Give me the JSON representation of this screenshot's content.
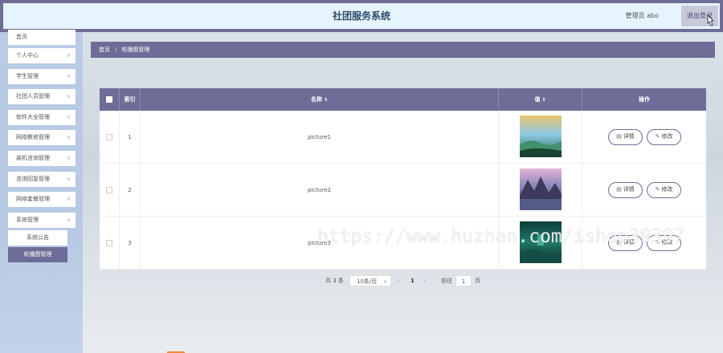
{
  "header": {
    "app_title": "社团服务系统",
    "user_label": "管理员 abo",
    "logout_label": "退出登录"
  },
  "sidebar": {
    "items": [
      {
        "label": "首页"
      },
      {
        "label": "个人中心"
      },
      {
        "label": "学生管理"
      },
      {
        "label": "社团人员管理"
      },
      {
        "label": "软件大全管理"
      },
      {
        "label": "网络教修管理"
      },
      {
        "label": "装机咨询管理"
      },
      {
        "label": "咨询回复管理"
      },
      {
        "label": "网络套餐管理"
      },
      {
        "label": "系统管理"
      }
    ],
    "sub_items": [
      {
        "label": "系统公告",
        "active": false
      },
      {
        "label": "轮播图管理",
        "active": true
      }
    ]
  },
  "breadcrumb": {
    "home": "首页",
    "separator": "/",
    "current": "轮播图管理"
  },
  "table": {
    "columns": {
      "index": "索引",
      "name": "名称",
      "value": "值",
      "actions": "操作"
    },
    "sort_icon": "⇕",
    "rows": [
      {
        "index": "1",
        "name": "picture1"
      },
      {
        "index": "2",
        "name": "picture2"
      },
      {
        "index": "3",
        "name": "picture3"
      }
    ],
    "detail_label": "详情",
    "edit_label": "修改"
  },
  "pagination": {
    "total": "共 3 条",
    "page_size": "10条/页",
    "current_page": "1",
    "goto_label": "前往",
    "goto_value": "1",
    "page_unit": "页"
  },
  "watermark": "https://www.huzhan.com/ishop39397",
  "colors": {
    "accent": "#6e6d97",
    "header_bg": "#e6f4fd",
    "sidebar_bg": "#b9cbe5"
  }
}
